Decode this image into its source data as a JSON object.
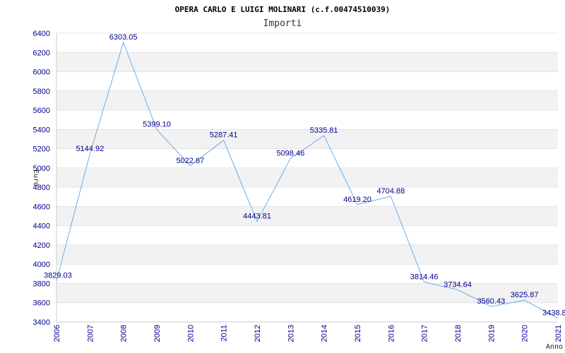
{
  "chart_data": {
    "type": "line",
    "title": "OPERA CARLO E LUIGI MOLINARI (c.f.00474510039)",
    "subtitle": "Importi",
    "ylabel": "Euro",
    "xlabel": "Anno",
    "ylim": [
      3400,
      6400
    ],
    "yticks": [
      3400,
      3600,
      3800,
      4000,
      4200,
      4400,
      4600,
      4800,
      5000,
      5200,
      5400,
      5600,
      5800,
      6000,
      6200,
      6400
    ],
    "grid": "alternating horizontal bands",
    "categories": [
      "2006",
      "2007",
      "2008",
      "2009",
      "2010",
      "2011",
      "2012",
      "2013",
      "2014",
      "2015",
      "2016",
      "2017",
      "2018",
      "2019",
      "2020",
      "2021"
    ],
    "values": [
      3829.03,
      5144.92,
      6303.05,
      5399.1,
      5022.67,
      5287.41,
      4443.81,
      5098.46,
      5335.81,
      4619.2,
      4704.88,
      3814.46,
      3734.64,
      3560.43,
      3625.87,
      3438.8
    ],
    "data_labels": [
      "3829.03",
      "5144.92",
      "6303.05",
      "5399.10",
      "5022.67",
      "5287.41",
      "4443.81",
      "5098.46",
      "5335.81",
      "4619.20",
      "4704.88",
      "3814.46",
      "3734.64",
      "3560.43",
      "3625.87",
      "3438.8"
    ],
    "line_color": "#6aaee8",
    "band_color": "#f2f2f2",
    "tick_color": "#00008b"
  }
}
